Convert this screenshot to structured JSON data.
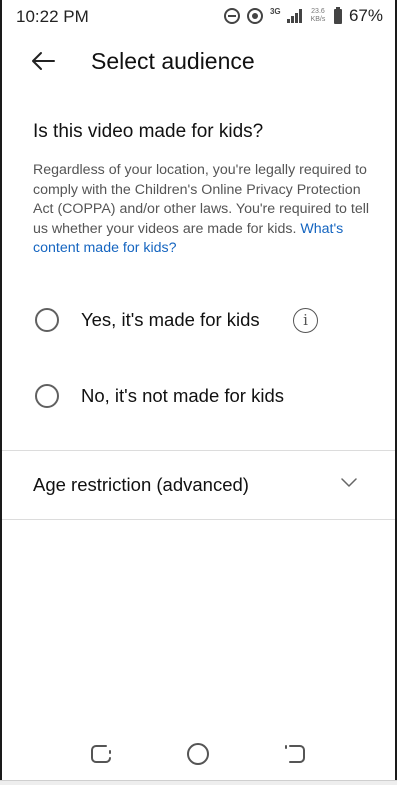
{
  "status_bar": {
    "time": "10:22 PM",
    "network_type": "3G",
    "speed": "23.6 KB/s",
    "battery": "67%",
    "icons": [
      "do-not-disturb-icon",
      "hotspot-icon",
      "signal-icon",
      "battery-icon"
    ]
  },
  "header": {
    "title": "Select audience",
    "back_icon": "arrow-left-icon"
  },
  "audience": {
    "question": "Is this video made for kids?",
    "description": "Regardless of your location, you're legally required to comply with the Children's Online Privacy Protection Act (COPPA) and/or other laws. You're required to tell us whether your videos are made for kids.",
    "link": "What's content made for kids?",
    "options": [
      {
        "label": "Yes, it's made for kids",
        "selected": false,
        "has_info": true
      },
      {
        "label": "No, it's not made for kids",
        "selected": false,
        "has_info": false
      }
    ],
    "info_icon_glyph": "i"
  },
  "age_restriction": {
    "label": "Age restriction (advanced)",
    "expanded": false
  },
  "nav_bar": {
    "icons": [
      "recent-apps-icon",
      "home-icon",
      "back-icon"
    ]
  },
  "colors": {
    "link": "#1565c0",
    "text": "#111111",
    "secondary_text": "#555555",
    "divider": "#dcdcdc"
  }
}
